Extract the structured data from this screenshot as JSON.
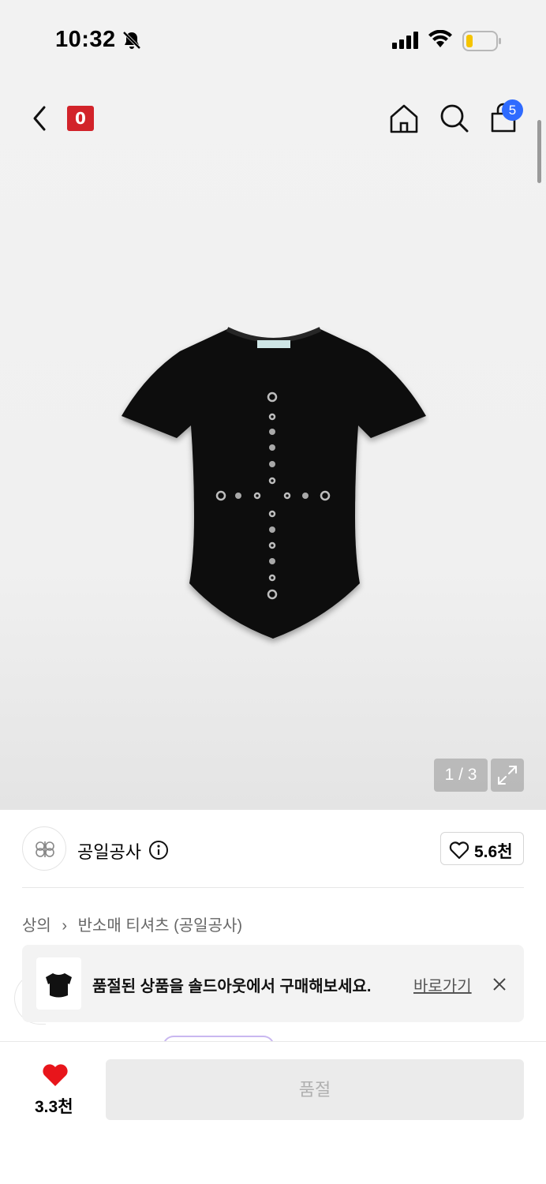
{
  "status_bar": {
    "time": "10:32"
  },
  "nav": {
    "brand_logo_text": "0",
    "cart_count": "5"
  },
  "gallery": {
    "pager": "1 / 3"
  },
  "brand": {
    "name": "공일공사",
    "likes": "5.6천"
  },
  "breadcrumb": {
    "category": "상의",
    "subcategory": "반소매 티셔츠 (공일공사)"
  },
  "soldout_banner": {
    "message": "품절된 상품을 솔드아웃에서 구매해보세요.",
    "link": "바로가기"
  },
  "bottom_bar": {
    "wish_count": "3.3천",
    "buy_label": "품절"
  },
  "colors": {
    "brand_red": "#d2232a",
    "badge_blue": "#2f6bff",
    "heart_red": "#e8151b"
  }
}
